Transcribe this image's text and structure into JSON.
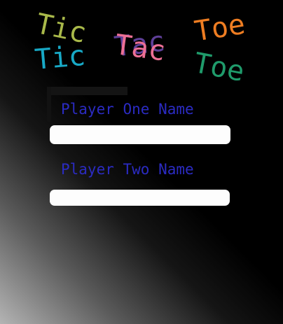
{
  "title": {
    "words": [
      {
        "text": "Tic",
        "color": "#a9b94a"
      },
      {
        "text": "Tic",
        "color": "#18a9c6"
      },
      {
        "text": "Tac",
        "color": "#ec6f95"
      },
      {
        "text": "Tac",
        "color": "#5e3f97"
      },
      {
        "text": "Toe",
        "color": "#ee7d22"
      },
      {
        "text": "Toe",
        "color": "#1f9b6b"
      }
    ]
  },
  "form": {
    "label_color": "#2b2bc2",
    "player_one": {
      "label": "Player One Name",
      "value": "",
      "placeholder": ""
    },
    "player_two": {
      "label": "Player Two Name",
      "value": "",
      "placeholder": ""
    }
  }
}
